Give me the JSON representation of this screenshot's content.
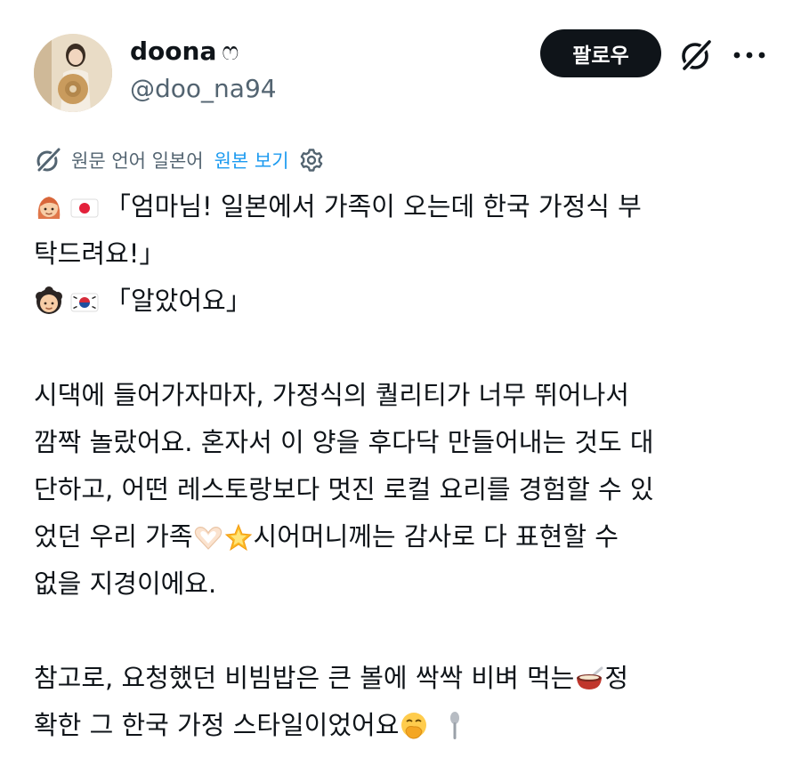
{
  "user": {
    "display_name": "doona",
    "name_symbol": "ෆ",
    "handle": "@doo_na94"
  },
  "actions": {
    "follow_label": "팔로우",
    "grok_icon": "grok-icon",
    "more_icon": "more-icon"
  },
  "translation": {
    "original_language": "원문 언어 일본어",
    "view_original": "원본 보기"
  },
  "post": {
    "line1_text": "「엄마님! 일본에서 가족이 오는데 한국 가정식 부",
    "line2_text": "탁드려요!」",
    "line3_text": "「알았어요」",
    "line4_text": "시댁에 들어가자마자, 가정식의 퀄리티가 너무 뛰어나서",
    "line5_text": "깜짝 놀랐어요. 혼자서 이 양을 후다닥 만들어내는 것도 대",
    "line6_text": "단하고, 어떤 레스토랑보다 멋진 로컬 요리를 경험할 수 있",
    "line7_a": "었던 우리 가족",
    "line7_b": "시어머니께는 감사로 다 표현할 수",
    "line8_text": "없을 지경이에요.",
    "line9_a": "참고로, 요청했던 비빔밥은 큰 볼에 싹싹 비벼 먹는",
    "line9_b": "정",
    "line10_text": "확한 그 한국 가정 스타일이었어요"
  },
  "emoji": [
    "woman-red-hair-emoji",
    "japan-flag-emoji",
    "older-woman-emoji",
    "korea-flag-emoji",
    "heart-hands-emoji",
    "glowing-star-emoji",
    "bowl-with-spoon-emoji",
    "hand-over-mouth-emoji",
    "spoon-emoji"
  ],
  "colors": {
    "text": "#0f1419",
    "secondary": "#536471",
    "link": "#1d9bf0",
    "button_bg": "#0f1419",
    "button_text": "#ffffff"
  }
}
